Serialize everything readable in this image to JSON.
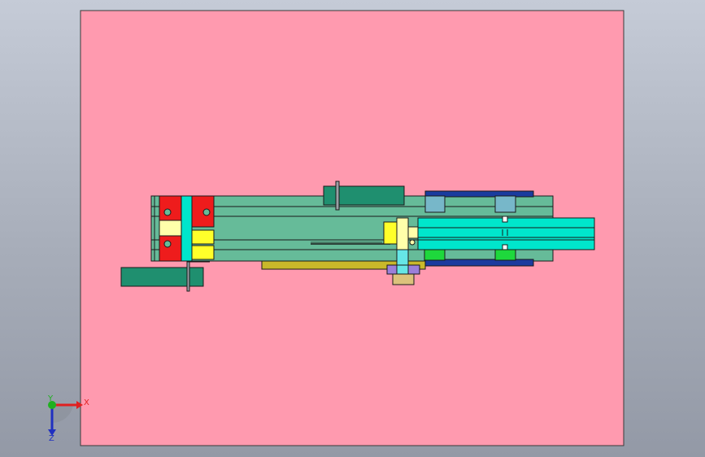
{
  "colors": {
    "sheet": "#ff9aaf",
    "body_green": "#66bb99",
    "cylinder_teal": "#1f8f6f",
    "block_red": "#ee1c1c",
    "yellow": "#ffff2a",
    "cream": "#ffffaa",
    "cyan": "#00e6cc",
    "light_cyan": "#66e6e6",
    "steel_blue": "#77b7c9",
    "navy": "#1a3b9e",
    "bright_green": "#1ed83c",
    "violet": "#9b7fd9",
    "tan": "#dcc27c",
    "olive": "#c9b82a"
  },
  "triad": {
    "x_label": "X",
    "y_label": "Y",
    "z_label": "Z",
    "x_color": "#e02020",
    "y_color": "#20b020",
    "z_color": "#2030c0"
  }
}
